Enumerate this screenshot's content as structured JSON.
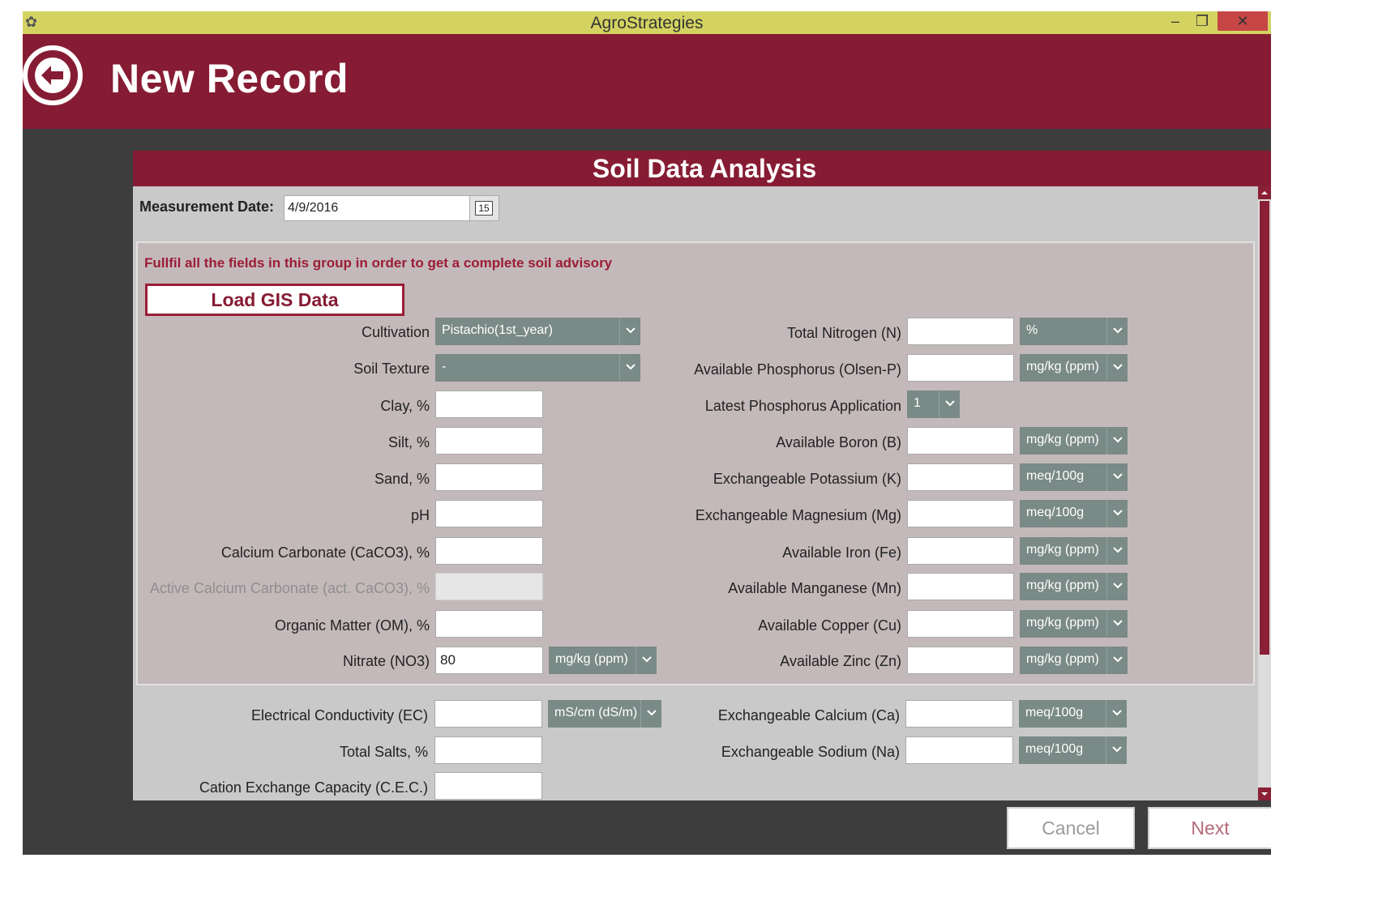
{
  "window": {
    "title": "AgroStrategies",
    "min": "–",
    "max": "❐",
    "close": "✕"
  },
  "header": {
    "title": "New Record"
  },
  "panel": {
    "title": "Soil Data Analysis"
  },
  "measurement": {
    "label": "Measurement Date:",
    "value": "4/9/2016",
    "calendar_day": "15"
  },
  "group": {
    "note": "Fullfil all the fields in this group in order to get a complete soil advisory",
    "gis_button": "Load GIS Data"
  },
  "left_fields": {
    "cultivation": {
      "label": "Cultivation",
      "value": "Pistachio(1st_year)"
    },
    "soil_texture": {
      "label": "Soil Texture",
      "value": "-"
    },
    "clay": {
      "label": "Clay, %",
      "value": ""
    },
    "silt": {
      "label": "Silt, %",
      "value": ""
    },
    "sand": {
      "label": "Sand, %",
      "value": ""
    },
    "ph": {
      "label": "pH",
      "value": ""
    },
    "caco3": {
      "label": "Calcium Carbonate (CaCO3), %",
      "value": ""
    },
    "act_caco3": {
      "label": "Active Calcium Carbonate (act. CaCO3), %",
      "value": ""
    },
    "om": {
      "label": "Organic Matter (OM), %",
      "value": ""
    },
    "nitrate": {
      "label": "Nitrate (NO3)",
      "value": "80",
      "unit": "mg/kg (ppm)"
    }
  },
  "right_fields": {
    "nitrogen": {
      "label": "Total Nitrogen (N)",
      "value": "",
      "unit": "%"
    },
    "phosphorus": {
      "label": "Available Phosphorus (Olsen-P)",
      "value": "",
      "unit": "mg/kg (ppm)"
    },
    "latest_p": {
      "label": "Latest Phosphorus Application",
      "value": "1"
    },
    "boron": {
      "label": "Available Boron (B)",
      "value": "",
      "unit": "mg/kg (ppm)"
    },
    "potassium": {
      "label": "Exchangeable Potassium (K)",
      "value": "",
      "unit": "meq/100g"
    },
    "magnesium": {
      "label": "Exchangeable Magnesium (Mg)",
      "value": "",
      "unit": "meq/100g"
    },
    "iron": {
      "label": "Available Iron (Fe)",
      "value": "",
      "unit": "mg/kg (ppm)"
    },
    "manganese": {
      "label": "Available Manganese (Mn)",
      "value": "",
      "unit": "mg/kg (ppm)"
    },
    "copper": {
      "label": "Available Copper (Cu)",
      "value": "",
      "unit": "mg/kg (ppm)"
    },
    "zinc": {
      "label": "Available Zinc (Zn)",
      "value": "",
      "unit": "mg/kg (ppm)"
    }
  },
  "lower_fields": {
    "ec": {
      "label": "Electrical Conductivity (EC)",
      "value": "",
      "unit": "mS/cm (dS/m)"
    },
    "total_salts": {
      "label": "Total Salts, %",
      "value": ""
    },
    "cec": {
      "label": "Cation Exchange Capacity (C.E.C.)",
      "value": ""
    },
    "calcium": {
      "label": "Exchangeable Calcium (Ca)",
      "value": "",
      "unit": "meq/100g"
    },
    "sodium": {
      "label": "Exchangeable Sodium (Na)",
      "value": "",
      "unit": "meq/100g"
    }
  },
  "footer": {
    "cancel": "Cancel",
    "next": "Next"
  },
  "colors": {
    "accent": "#861c33",
    "titlebar": "#d4d362",
    "select": "#7a8a86",
    "group_bg": "#c4b9ba",
    "panel_bg": "#c9c9c9",
    "body_bg": "#3d3d3d"
  }
}
